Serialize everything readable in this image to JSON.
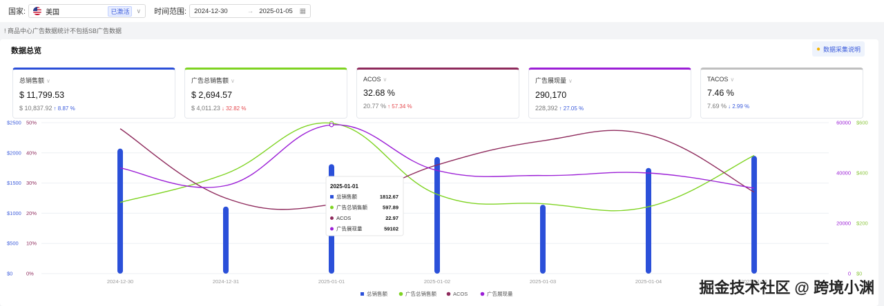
{
  "filters": {
    "country_label": "国家:",
    "country_value": "美国",
    "country_status": "已激活",
    "time_label": "时间范围:",
    "date_start": "2024-12-30",
    "date_end": "2025-01-05"
  },
  "notice": "! 商品中心广告数据统计不包括SB广告数据",
  "panel": {
    "title": "数据总览",
    "help": "数据采集说明"
  },
  "cards": [
    {
      "name": "总销售额",
      "value": "$ 11,799.53",
      "prev": "$ 10,837.92",
      "change": "↑ 8.87 %",
      "dir": "up",
      "color": "#2b4fd8"
    },
    {
      "name": "广告总销售额",
      "value": "$ 2,694.57",
      "prev": "$ 4,011.23",
      "change": "↓ 32.82 %",
      "dir": "down",
      "color": "#7ed321"
    },
    {
      "name": "ACOS",
      "value": "32.68 %",
      "prev": "20.77 %",
      "change": "↑ 57.34 %",
      "dir": "down",
      "color": "#8e2a5c"
    },
    {
      "name": "广告展现量",
      "value": "290,170",
      "prev": "228,392",
      "change": "↑ 27.05 %",
      "dir": "up",
      "color": "#9b1ed6"
    },
    {
      "name": "TACOS",
      "value": "7.46 %",
      "prev": "7.69 %",
      "change": "↓ 2.99 %",
      "dir": "up",
      "color": "#bfbfbf"
    }
  ],
  "chart_data": {
    "type": "bar",
    "categories": [
      "2024-12-30",
      "2024-12-31",
      "2025-01-01",
      "2025-01-02",
      "2025-01-03",
      "2025-01-04",
      "2025-01-05"
    ],
    "series": [
      {
        "name": "总销售额",
        "type": "bar",
        "axis": "sales",
        "color": "#2b50d9",
        "values": [
          2070,
          1110,
          1812.67,
          1930,
          1140,
          1750,
          1950
        ]
      },
      {
        "name": "广告总销售额",
        "type": "line",
        "axis": "adsales",
        "color": "#7ed321",
        "values": [
          283,
          397,
          597.89,
          315,
          278,
          266,
          470
        ]
      },
      {
        "name": "ACOS",
        "type": "line",
        "axis": "acos",
        "color": "#8e2a5c",
        "values": [
          48,
          25,
          22.97,
          36,
          44,
          46,
          27
        ]
      },
      {
        "name": "广告展现量",
        "type": "line",
        "axis": "impr",
        "color": "#9b1ed6",
        "values": [
          42000,
          35000,
          59102,
          41000,
          39000,
          40000,
          34000
        ]
      }
    ],
    "axes": {
      "sales": {
        "ticks": [
          "$0",
          "$500",
          "$1000",
          "$1500",
          "$2000",
          "$2500"
        ],
        "max": 2500,
        "color": "#3b5bdb"
      },
      "acos": {
        "ticks": [
          "0%",
          "10%",
          "20%",
          "30%",
          "40%",
          "50%"
        ],
        "max": 50,
        "color": "#8e2a5c"
      },
      "impr": {
        "ticks": [
          "0",
          "20000",
          "40000",
          "60000"
        ],
        "max": 60000,
        "color": "#9b1ed6"
      },
      "adsales": {
        "ticks": [
          "$0",
          "$200",
          "$400",
          "$600"
        ],
        "max": 600,
        "color": "#8cc63f"
      }
    },
    "tooltip": {
      "title": "2025-01-01",
      "rows": [
        {
          "name": "总销售额",
          "value": "1812.67"
        },
        {
          "name": "广告总销售额",
          "value": "597.89"
        },
        {
          "name": "ACOS",
          "value": "22.97"
        },
        {
          "name": "广告展现量",
          "value": "59102"
        }
      ]
    },
    "grid": true,
    "legend_position": "bottom"
  },
  "watermark": "掘金技术社区 @ 跨境小渊"
}
